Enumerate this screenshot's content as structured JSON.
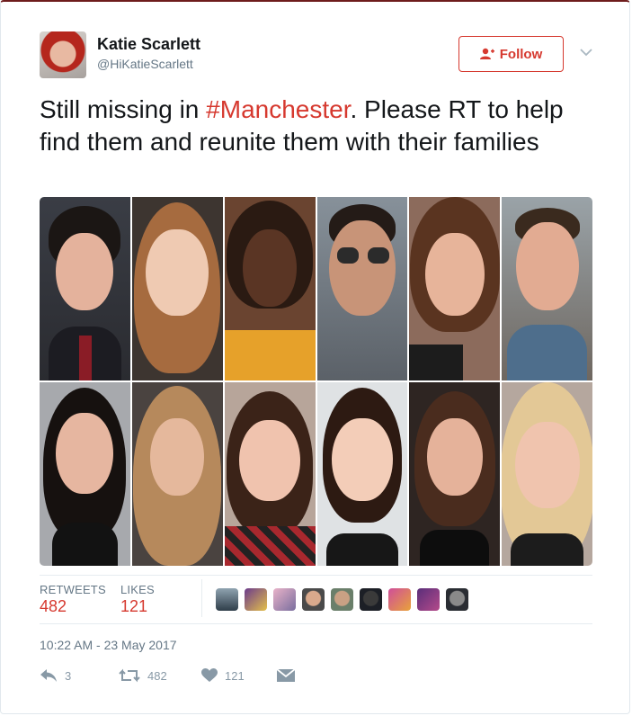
{
  "user": {
    "name": "Katie Scarlett",
    "handle": "@HiKatieScarlett"
  },
  "follow_button": {
    "label": "Follow"
  },
  "tweet": {
    "text_before": "Still missing in ",
    "hashtag": "#Manchester",
    "text_after": ". Please RT to help find them and reunite them with their families"
  },
  "stats": {
    "retweets_label": "RETWEETS",
    "retweets_value": "482",
    "likes_label": "LIKES",
    "likes_value": "121"
  },
  "timestamp": "10:22 AM - 23 May 2017",
  "actions": {
    "reply_count": "3",
    "retweet_count": "482",
    "like_count": "121"
  },
  "icons": {
    "follow": "add-user-icon",
    "menu": "chevron-down-icon",
    "reply": "reply-icon",
    "retweet": "retweet-icon",
    "like": "heart-icon",
    "dm": "envelope-icon"
  },
  "colors": {
    "accent": "#d6392f",
    "muted": "#657786",
    "action": "#8899a6"
  }
}
